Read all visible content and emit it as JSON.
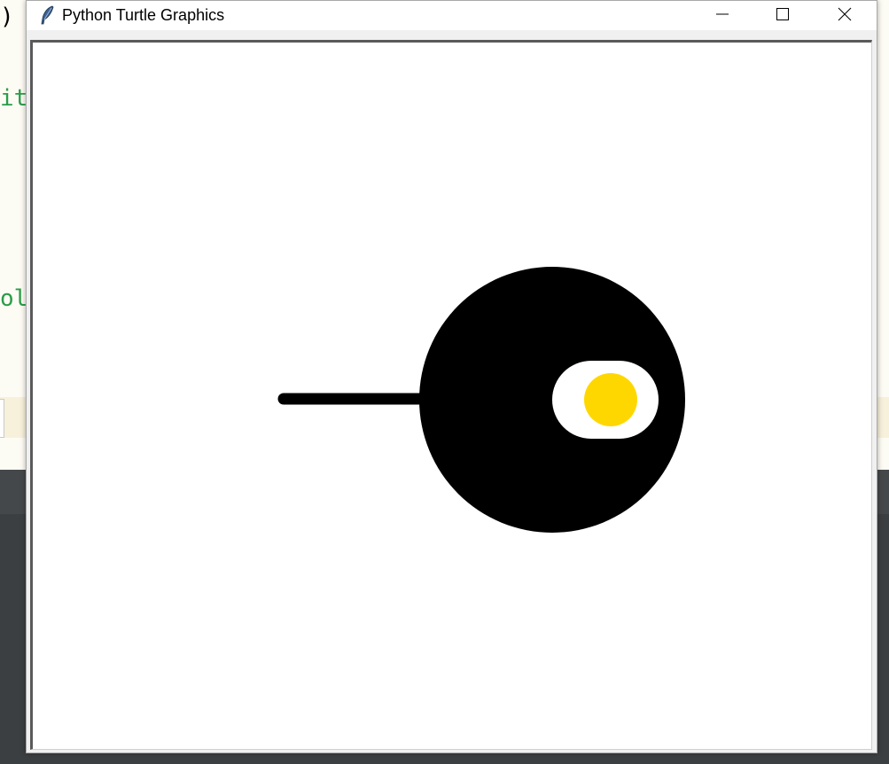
{
  "background_editor": {
    "code_fragments": [
      ")",
      "it",
      "ol"
    ],
    "text_color_green": "#2a9d4a"
  },
  "window": {
    "title": "Python Turtle Graphics",
    "icon": "feather-icon",
    "controls": {
      "minimize": "minimize-icon",
      "maximize": "maximize-icon",
      "close": "close-icon"
    }
  },
  "canvas": {
    "background_color": "#ffffff",
    "drawing": {
      "line_color": "#000000",
      "body_color": "#000000",
      "eye_white_color": "#ffffff",
      "pupil_color": "#ffd700"
    }
  }
}
